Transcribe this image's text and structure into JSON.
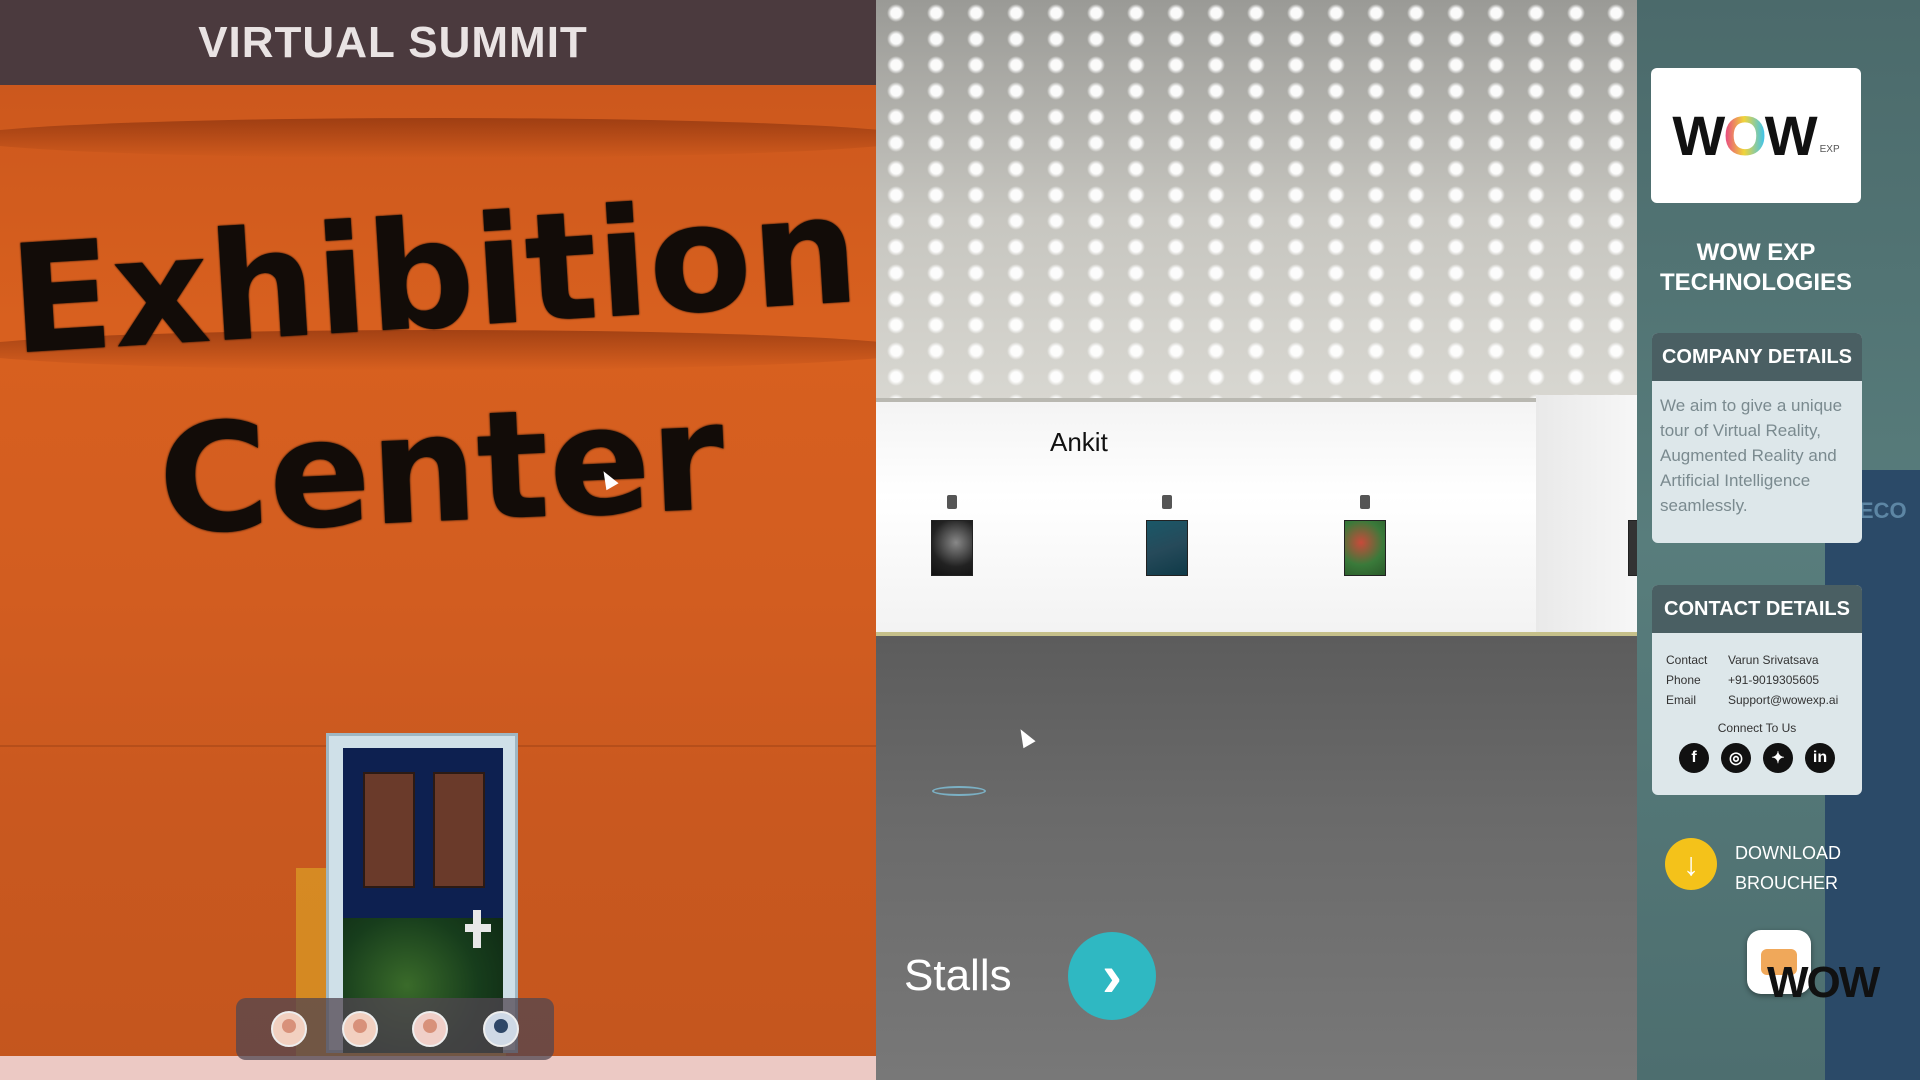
{
  "left_view": {
    "header_title": "VIRTUAL SUMMIT",
    "sign_line1": "Exhibition",
    "sign_line2": "Center",
    "avatar_count": 4
  },
  "hall_view": {
    "nametag": "Ankit",
    "stalls_label": "Stalls",
    "stalls_icon": "chevron-right-icon",
    "stalls_glyph": "›"
  },
  "side_panel": {
    "logo_text_left": "W",
    "logo_text_o": "O",
    "logo_text_right": "W",
    "logo_sub": "EXP",
    "company_name_line1": "WOW EXP",
    "company_name_line2": "TECHNOLOGIES",
    "company_details": {
      "title": "COMPANY DETAILS",
      "body": "We aim to give a unique tour of Virtual Reality, Augmented Reality and Artificial Intelligence seamlessly."
    },
    "contact_details": {
      "title": "CONTACT DETAILS",
      "contact_label": "Contact",
      "contact_value": "Varun Srivatsava",
      "phone_label": "Phone",
      "phone_value": "+91-9019305605",
      "email_label": "Email",
      "email_value": "Support@wowexp.ai",
      "connect_label": "Connect To Us",
      "socials": [
        "facebook-icon",
        "instagram-icon",
        "twitter-icon",
        "linkedin-icon"
      ]
    },
    "download": {
      "line1": "DOWNLOAD",
      "line2": "BROUCHER",
      "icon": "download-arrow-icon"
    },
    "mini_logo_text": "WOW",
    "bg_screen_text": "RECO"
  },
  "colors": {
    "stalls_button": "#2fb8c2",
    "header_bar": "#4b3a3e",
    "download_icon": "#f4c21a",
    "panel_card_header": "#4a5f63"
  }
}
